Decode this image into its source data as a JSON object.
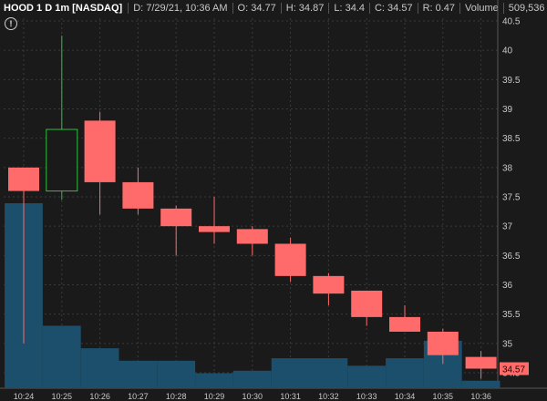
{
  "header": {
    "symbol_label": "HOOD 1 D 1m [NASDAQ]",
    "date_text": "D: 7/29/21, 10:36 AM",
    "open_text": "O: 34.77",
    "high_text": "H: 34.87",
    "low_text": "L: 34.4",
    "close_text": "C: 34.57",
    "range_text": "R: 0.47",
    "volume_label": "Volume",
    "volume_value": "509,536"
  },
  "info_symbol": "!",
  "colors": {
    "background": "#1a1a1a",
    "grid": "#3a3a3a",
    "up": "#2fbf3f",
    "down": "#ff6b6b",
    "volume": "#1c4f6b",
    "badge": "#ff6b6b"
  },
  "chart_data": {
    "type": "candlestick",
    "title": "",
    "x": [
      "10:24",
      "10:25",
      "10:26",
      "10:27",
      "10:28",
      "10:29",
      "10:30",
      "10:31",
      "10:32",
      "10:33",
      "10:34",
      "10:35",
      "10:36"
    ],
    "candles": [
      {
        "o": 38.0,
        "h": 38.0,
        "l": 35.0,
        "c": 37.6
      },
      {
        "o": 37.6,
        "h": 40.25,
        "l": 37.45,
        "c": 38.65
      },
      {
        "o": 38.8,
        "h": 38.95,
        "l": 37.2,
        "c": 37.75
      },
      {
        "o": 37.75,
        "h": 38.0,
        "l": 37.2,
        "c": 37.3
      },
      {
        "o": 37.3,
        "h": 37.35,
        "l": 36.5,
        "c": 37.0
      },
      {
        "o": 37.0,
        "h": 37.5,
        "l": 36.7,
        "c": 36.9
      },
      {
        "o": 36.95,
        "h": 37.0,
        "l": 36.5,
        "c": 36.7
      },
      {
        "o": 36.7,
        "h": 36.8,
        "l": 36.05,
        "c": 36.15
      },
      {
        "o": 36.15,
        "h": 36.2,
        "l": 35.65,
        "c": 35.85
      },
      {
        "o": 35.9,
        "h": 35.9,
        "l": 35.3,
        "c": 35.45
      },
      {
        "o": 35.45,
        "h": 35.65,
        "l": 35.2,
        "c": 35.2
      },
      {
        "o": 35.2,
        "h": 35.25,
        "l": 34.65,
        "c": 34.8
      },
      {
        "o": 34.77,
        "h": 34.87,
        "l": 34.4,
        "c": 34.57
      }
    ],
    "volume_relative": [
      0.74,
      0.25,
      0.16,
      0.11,
      0.11,
      0.06,
      0.07,
      0.12,
      0.12,
      0.09,
      0.12,
      0.19,
      0.03
    ],
    "ylim": [
      34.4,
      40.5
    ],
    "yticks": [
      "40.5",
      "40",
      "39.5",
      "39",
      "38.5",
      "38",
      "37.5",
      "37",
      "36.5",
      "36",
      "35.5",
      "35",
      "34.5"
    ],
    "last_price_label": "34.57",
    "grid": true
  }
}
